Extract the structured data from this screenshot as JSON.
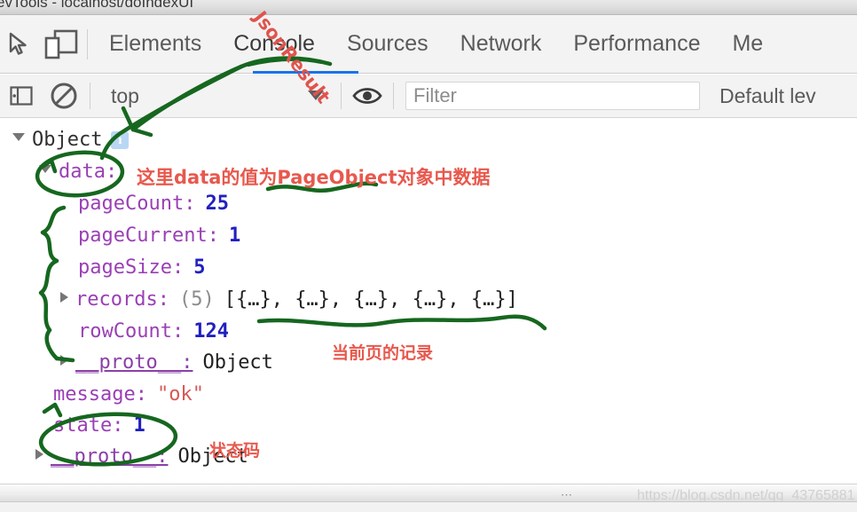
{
  "window": {
    "title": "evTools - localhost/doIndexUI"
  },
  "toolbar": {
    "inspect_icon": "inspect-cursor-icon",
    "device_icon": "device-toolbar-icon",
    "tabs": [
      {
        "label": "Elements",
        "active": false
      },
      {
        "label": "Console",
        "active": true
      },
      {
        "label": "Sources",
        "active": false
      },
      {
        "label": "Network",
        "active": false
      },
      {
        "label": "Performance",
        "active": false
      },
      {
        "label": "Me",
        "active": false
      }
    ]
  },
  "console_toolbar": {
    "clear_icon": "clear-console-icon",
    "sidebar_icon": "console-sidebar-icon",
    "context": "top",
    "eye_icon": "live-expression-eye-icon",
    "filter_placeholder": "Filter",
    "filter_value": "",
    "levels_label": "Default lev"
  },
  "console_output": {
    "root": {
      "label": "Object",
      "badge": "i"
    },
    "rows": [
      {
        "id": "data",
        "key": "data:",
        "value": "",
        "type": "expanded-object",
        "indent": 1
      },
      {
        "id": "pageCount",
        "key": "pageCount:",
        "value": "25",
        "type": "number",
        "indent": 2
      },
      {
        "id": "pageCurrent",
        "key": "pageCurrent:",
        "value": "1",
        "type": "number",
        "indent": 2
      },
      {
        "id": "pageSize",
        "key": "pageSize:",
        "value": "5",
        "type": "number",
        "indent": 2
      },
      {
        "id": "records",
        "key": "records:",
        "count": "(5)",
        "value": "[{…}, {…}, {…}, {…}, {…}]",
        "type": "array",
        "indent": 2
      },
      {
        "id": "rowCount",
        "key": "rowCount:",
        "value": "124",
        "type": "number",
        "indent": 2
      },
      {
        "id": "proto-inner",
        "key": "__proto__:",
        "value": "Object",
        "type": "proto",
        "indent": 2
      },
      {
        "id": "message",
        "key": "message:",
        "value": "\"ok\"",
        "type": "string",
        "indent": 1
      },
      {
        "id": "state",
        "key": "state:",
        "value": "1",
        "type": "number",
        "indent": 1
      },
      {
        "id": "proto-outer",
        "key": "__proto__:",
        "value": "Object",
        "type": "proto",
        "indent": 1
      }
    ]
  },
  "annotations": {
    "jsonresult": "JsonResult",
    "data_note": "这里data的值为PageObject对象中数据",
    "records_note": "当前页的记录",
    "state_note": "状态码"
  },
  "statusbar": {
    "grip": "⋯",
    "watermark": "https://blog.csdn.net/qq_43765881"
  },
  "colors": {
    "accent": "#1a73e8",
    "annotation_red": "#e8584d",
    "annotation_green": "#16671f",
    "key_purple": "#9a3fb5",
    "number_blue": "#2020c0",
    "string_red": "#c41a16"
  }
}
